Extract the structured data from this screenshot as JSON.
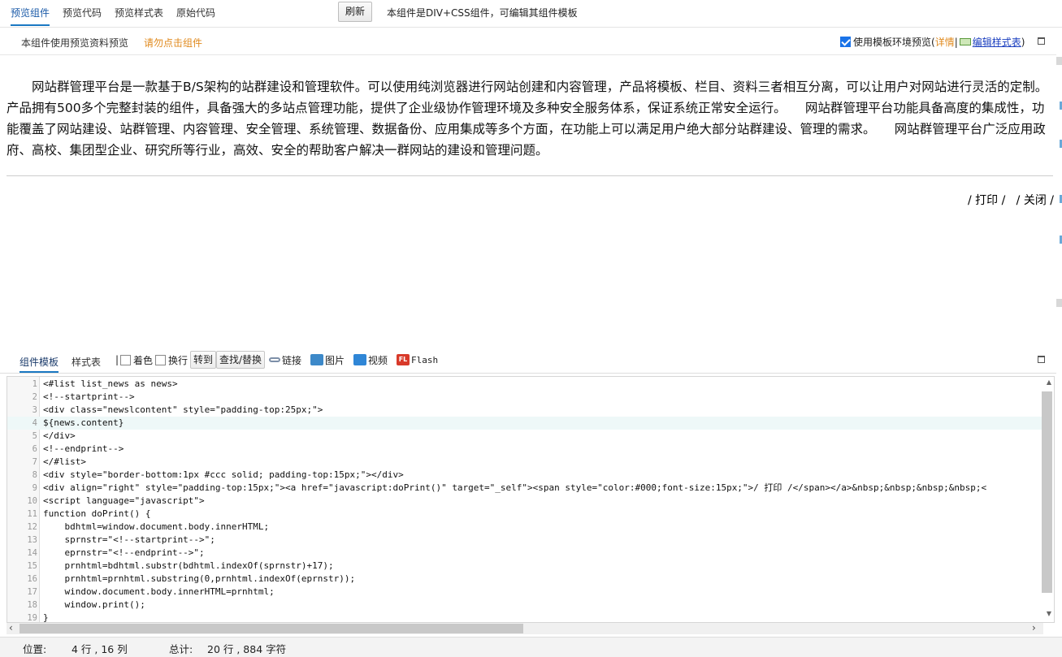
{
  "top_tabs": [
    "预览组件",
    "预览代码",
    "预览样式表",
    "原始代码"
  ],
  "refresh_label": "刷新",
  "top_note": "本组件是DIV+CSS组件，可编辑其组件模板",
  "subheader": {
    "left_label": "本组件使用预览资料预览",
    "warning": "请勿点击组件",
    "use_template_env": "使用模板环境预览",
    "paren_open": "(",
    "details": "详情",
    "separator": "|",
    "edit_stylesheet": "编辑样式表",
    "paren_close": ")",
    "use_template_checked": true
  },
  "preview": {
    "paragraph": "网站群管理平台是一款基于B/S架构的站群建设和管理软件。可以使用纯浏览器进行网站创建和内容管理，产品将模板、栏目、资料三者相互分离，可以让用户对网站进行灵活的定制。产品拥有500多个完整封装的组件，具备强大的多站点管理功能，提供了企业级协作管理环境及多种安全服务体系，保证系统正常安全运行。　　网站群管理平台功能具备高度的集成性，功能覆盖了网站建设、站群管理、内容管理、安全管理、系统管理、数据备份、应用集成等多个方面，在功能上可以满足用户绝大部分站群建设、管理的需求。　　网站群管理平台广泛应用政府、高校、集团型企业、研究所等行业，高效、安全的帮助客户解决一群网站的建设和管理问题。",
    "print_label": "/ 打印 /",
    "close_label": "/ 关闭 /"
  },
  "editor_tabs": [
    "组件模板",
    "样式表"
  ],
  "toolbar": {
    "divider": "|",
    "color_label": "着色",
    "wrap_label": "换行",
    "goto_label": "转到",
    "find_replace_label": "查找/替换",
    "link_label": "链接",
    "image_label": "图片",
    "video_label": "视频",
    "flash_label": "Flash",
    "flash_icon_text": "FL"
  },
  "code_lines": [
    "<#list list_news as news>",
    "<!--startprint-->",
    "<div class=\"newslcontent\" style=\"padding-top:25px;\">",
    "${news.content}",
    "</div>",
    "<!--endprint-->",
    "</#list>",
    "<div style=\"border-bottom:1px #ccc solid; padding-top:15px;\"></div>",
    "<div align=\"right\" style=\"padding-top:15px;\"><a href=\"javascript:doPrint()\" target=\"_self\"><span style=\"color:#000;font-size:15px;\">/ 打印 /</span></a>&nbsp;&nbsp;&nbsp;&nbsp;<",
    "<script language=\"javascript\">",
    "function doPrint() {",
    "    bdhtml=window.document.body.innerHTML;",
    "    sprnstr=\"<!--startprint-->\";",
    "    eprnstr=\"<!--endprint-->\";",
    "    prnhtml=bdhtml.substr(bdhtml.indexOf(sprnstr)+17);",
    "    prnhtml=prnhtml.substring(0,prnhtml.indexOf(eprnstr));",
    "    window.document.body.innerHTML=prnhtml;",
    "    window.print();",
    "}"
  ],
  "highlighted_line": 4,
  "scroll_arrows": {
    "left": "‹",
    "right": "›",
    "up": "▲",
    "down": "▼"
  },
  "status": {
    "position_label": "位置:",
    "position_value": "4 行 , 16 列",
    "total_label": "总计:",
    "total_value": "20 行 , 884 字符"
  },
  "colors": {
    "accent": "#1a78c2",
    "warning": "#e08a1e",
    "link": "#1a3ebf"
  }
}
